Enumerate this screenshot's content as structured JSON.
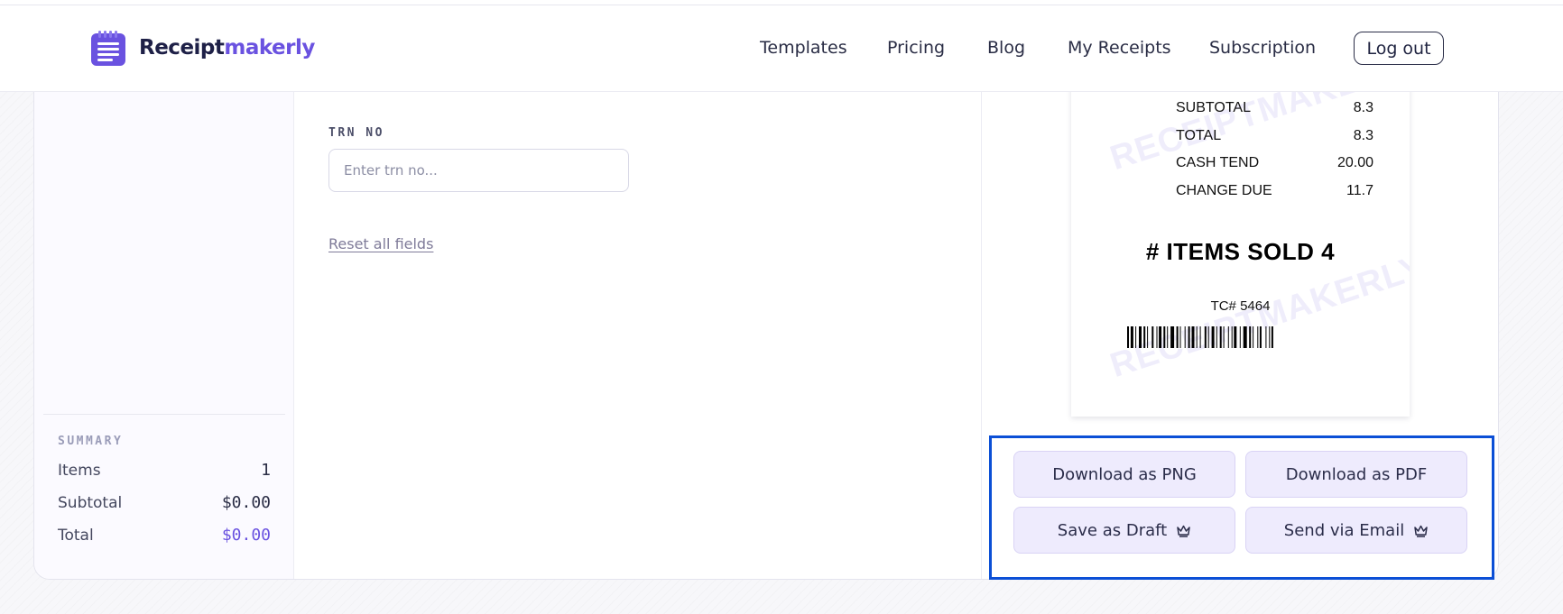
{
  "header": {
    "logo": {
      "part1": "Receipt",
      "part2": "makerly"
    },
    "nav": [
      {
        "label": "Templates"
      },
      {
        "label": "Pricing"
      },
      {
        "label": "Blog"
      },
      {
        "label": "My Receipts"
      },
      {
        "label": "Subscription"
      }
    ],
    "logout_label": "Log out"
  },
  "sidebar": {
    "summary_title": "SUMMARY",
    "rows": [
      {
        "label": "Items",
        "value": "1"
      },
      {
        "label": "Subtotal",
        "value": "$0.00"
      },
      {
        "label": "Total",
        "value": "$0.00"
      }
    ]
  },
  "form": {
    "trn_label": "TRN NO",
    "trn_placeholder": "Enter trn no...",
    "trn_value": "",
    "reset_label": "Reset all fields"
  },
  "receipt": {
    "rows": [
      {
        "label": "SUBTOTAL",
        "value": "8.3"
      },
      {
        "label": "TOTAL",
        "value": "8.3"
      },
      {
        "label": "CASH TEND",
        "value": "20.00"
      },
      {
        "label": "CHANGE DUE",
        "value": "11.7"
      }
    ],
    "items_sold": "# ITEMS SOLD 4",
    "tc_number": "TC# 5464",
    "watermark": "RECEIPTMAKERLY"
  },
  "actions": {
    "download_png": "Download as PNG",
    "download_pdf": "Download as PDF",
    "save_draft": "Save as Draft",
    "send_email": "Send via Email"
  },
  "colors": {
    "brand": "#6a52e0",
    "highlight_frame": "#0b4fd6",
    "button_bg": "#eeebfd"
  },
  "icons": [
    "notepad-logo-icon",
    "crown-icon"
  ]
}
